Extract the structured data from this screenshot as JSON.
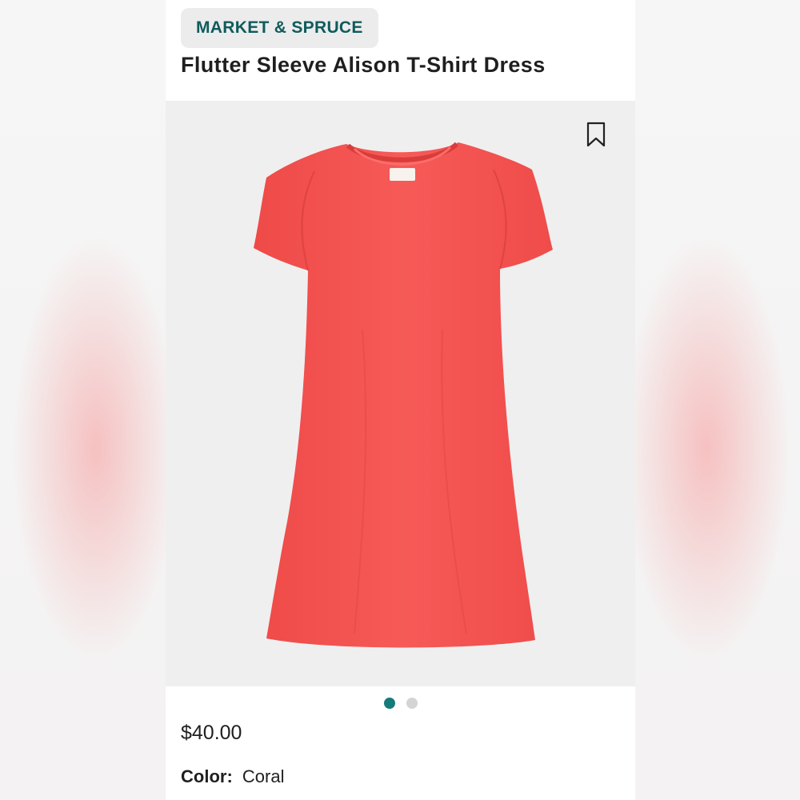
{
  "product": {
    "brand": "MARKET & SPRUCE",
    "title": "Flutter Sleeve Alison T-Shirt Dress",
    "price": "$40.00",
    "color_label": "Color:",
    "color_value": "Coral"
  },
  "gallery": {
    "image_count": 2,
    "active_index": 0,
    "product_image_color": "#f35452"
  },
  "icons": {
    "bookmark": "bookmark-icon"
  },
  "theme": {
    "brand_text": "#0f5b5c",
    "active_dot": "#157a7a",
    "inactive_dot": "#d2d4d6"
  }
}
